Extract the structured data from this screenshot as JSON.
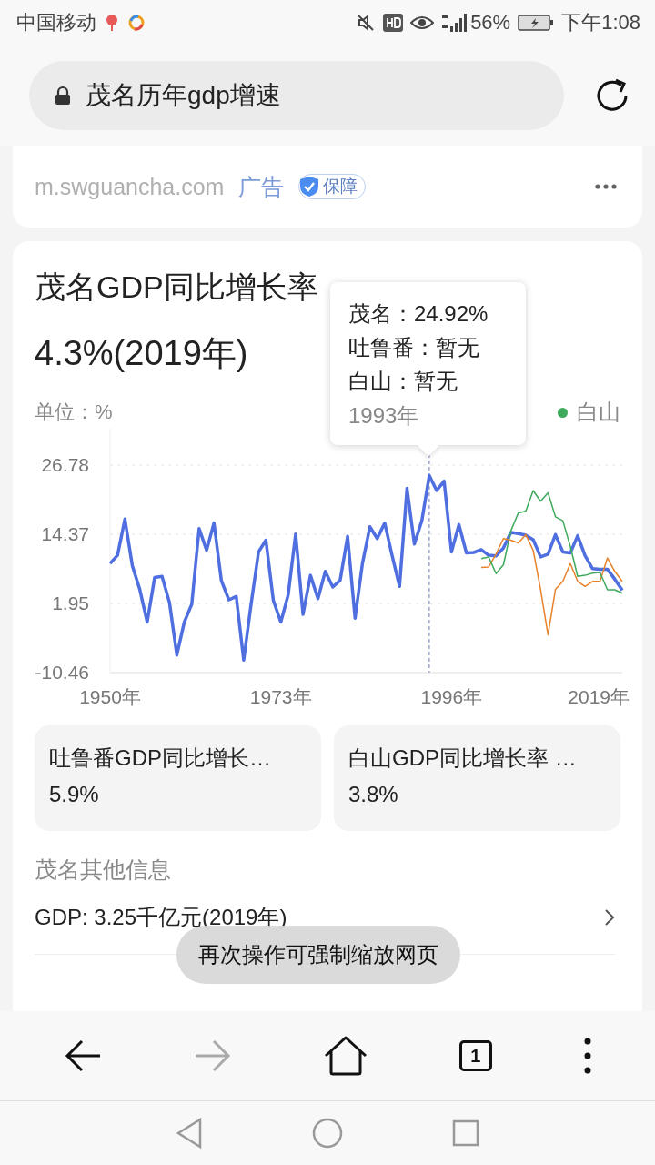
{
  "status_bar": {
    "carrier": "中国移动",
    "battery": "56%",
    "time": "下午1:08"
  },
  "search": {
    "query": "茂名历年gdp增速"
  },
  "ad": {
    "domain": "m.swguancha.com",
    "label": "广告",
    "badge": "保障"
  },
  "card": {
    "title": "茂名GDP同比增长率",
    "value": "4.3%(2019年)",
    "unit": "单位：%",
    "legend": [
      {
        "label": "白山",
        "color": "#3daa5c"
      }
    ],
    "tooltip": {
      "separator": "：",
      "values": [
        "24.92%",
        "暂无",
        "暂无"
      ],
      "date": "1993年"
    },
    "chart_data": {
      "type": "line",
      "x": [
        1950,
        1951,
        1952,
        1953,
        1954,
        1955,
        1956,
        1957,
        1958,
        1959,
        1960,
        1961,
        1962,
        1963,
        1964,
        1965,
        1966,
        1967,
        1968,
        1969,
        1970,
        1971,
        1972,
        1973,
        1974,
        1975,
        1976,
        1977,
        1978,
        1979,
        1980,
        1981,
        1982,
        1983,
        1984,
        1985,
        1986,
        1987,
        1988,
        1989,
        1990,
        1991,
        1992,
        1993,
        1994,
        1995,
        1996,
        1997,
        1998,
        1999,
        2000,
        2001,
        2002,
        2003,
        2004,
        2005,
        2006,
        2007,
        2008,
        2009,
        2010,
        2011,
        2012,
        2013,
        2014,
        2015,
        2016,
        2017,
        2018,
        2019
      ],
      "xlim": [
        1950,
        2019
      ],
      "ylim": [
        -10.46,
        26.78
      ],
      "ref_lines": [
        {
          "axis": "x",
          "value": 1993
        }
      ],
      "yticks": [
        -10.46,
        1.95,
        14.37,
        26.78
      ],
      "xticks": [
        {
          "value": 1950,
          "label": "1950年"
        },
        {
          "value": 1973,
          "label": "1973年"
        },
        {
          "value": 1996,
          "label": "1996年"
        },
        {
          "value": 2019,
          "label": "2019年"
        }
      ],
      "series": [
        {
          "name": "茂名",
          "color": "#4f6ee0",
          "values": [
            9.1,
            10.6,
            17.1,
            8.7,
            4.5,
            -1.4,
            6.6,
            6.8,
            2.1,
            -7.3,
            -1.4,
            1.8,
            15.4,
            11.5,
            16.4,
            6.0,
            2.6,
            3.2,
            -8.2,
            1.8,
            11.2,
            13.3,
            2.5,
            -1.4,
            3.5,
            14.4,
            0.0,
            7.0,
            2.8,
            7.7,
            4.9,
            6.1,
            14.0,
            -0.7,
            9.1,
            15.7,
            13.6,
            16.4,
            10.5,
            5.0,
            22.6,
            12.6,
            16.8,
            24.9,
            22.2,
            23.9,
            11.2,
            16.1,
            11.0,
            11.1,
            11.6,
            10.6,
            10.5,
            11.9,
            14.7,
            14.5,
            14.2,
            13.4,
            10.3,
            10.8,
            14.3,
            11.2,
            11.0,
            14.1,
            10.5,
            8.2,
            8.1,
            8.1,
            6.3,
            4.3
          ]
        },
        {
          "name": "吐鲁番",
          "color": "#e8822a",
          "values": [
            null,
            null,
            null,
            null,
            null,
            null,
            null,
            null,
            null,
            null,
            null,
            null,
            null,
            null,
            null,
            null,
            null,
            null,
            null,
            null,
            null,
            null,
            null,
            null,
            null,
            null,
            null,
            null,
            null,
            null,
            null,
            null,
            null,
            null,
            null,
            null,
            null,
            null,
            null,
            null,
            null,
            null,
            null,
            null,
            null,
            null,
            null,
            null,
            null,
            null,
            8.4,
            8.5,
            10.8,
            13.6,
            13.3,
            12.8,
            14.3,
            11.5,
            4.5,
            -3.7,
            4.5,
            5.9,
            9.1,
            5.9,
            5.0,
            5.9,
            5.9,
            10.1,
            7.7,
            5.9
          ]
        },
        {
          "name": "白山",
          "color": "#3daa5c",
          "values": [
            null,
            null,
            null,
            null,
            null,
            null,
            null,
            null,
            null,
            null,
            null,
            null,
            null,
            null,
            null,
            null,
            null,
            null,
            null,
            null,
            null,
            null,
            null,
            null,
            null,
            null,
            null,
            null,
            null,
            null,
            null,
            null,
            null,
            null,
            null,
            null,
            null,
            null,
            null,
            null,
            null,
            null,
            null,
            null,
            null,
            null,
            null,
            null,
            null,
            null,
            10.0,
            10.3,
            7.3,
            8.9,
            15.0,
            18.2,
            18.5,
            22.2,
            20.3,
            21.8,
            17.5,
            16.8,
            12.2,
            6.8,
            7.0,
            7.4,
            7.5,
            4.4,
            4.4,
            3.8
          ]
        }
      ]
    }
  },
  "related": [
    {
      "title": "吐鲁番GDP同比增长…",
      "value": "5.9%"
    },
    {
      "title": "白山GDP同比增长率 …",
      "value": "3.8%"
    }
  ],
  "other": {
    "heading": "茂名其他信息",
    "rows": [
      "GDP: 3.25千亿元(2019年)"
    ]
  },
  "toast": "再次操作可强制缩放网页",
  "toolbar": {
    "tab_count": "1",
    "forward_disabled": true
  }
}
